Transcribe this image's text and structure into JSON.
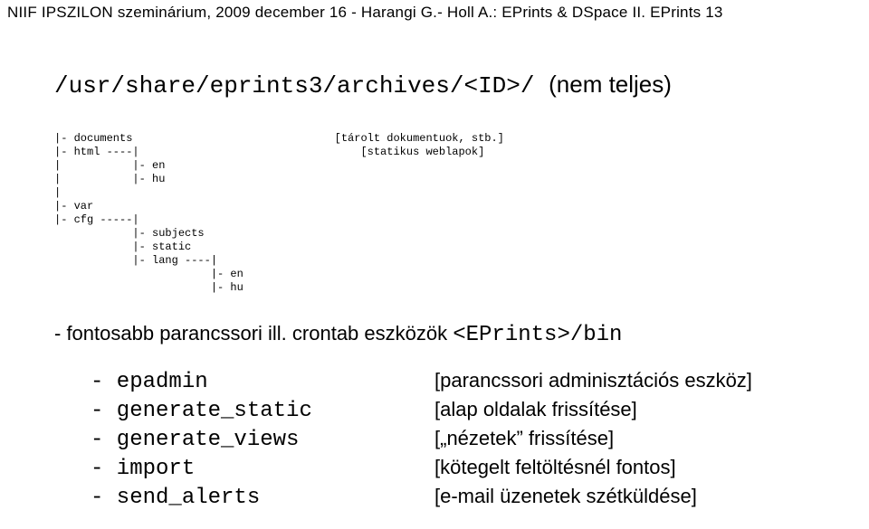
{
  "header": "NIIF IPSZILON szeminárium, 2009 december 16  -  Harangi G.- Holl A.: EPrints & DSpace  II.  EPrints  13",
  "heading_path": "/usr/share/eprints3/archives/<ID>/",
  "heading_note": "(nem teljes)",
  "tree": "|- documents                               [tárolt dokumentuok, stb.]\n|- html ----|                                  [statikus weblapok]\n|           |- en\n|           |- hu\n|\n|- var\n|- cfg -----|\n            |- subjects\n            |- static\n            |- lang ----|\n                        |- en\n                        |- hu",
  "subhead_prefix": "- fontosabb parancssori ill. crontab eszközök ",
  "subhead_mono": "<EPrints>/bin",
  "tools": [
    {
      "name": "- epadmin",
      "desc": "[parancssori adminisztációs eszköz]"
    },
    {
      "name": "- generate_static",
      "desc": "[alap oldalak frissítése]"
    },
    {
      "name": "- generate_views",
      "desc": "[„nézetek” frissítése]"
    },
    {
      "name": "- import",
      "desc": "[kötegelt feltöltésnél fontos]"
    },
    {
      "name": "- send_alerts",
      "desc": "[e-mail üzenetek szétküldése]"
    }
  ]
}
